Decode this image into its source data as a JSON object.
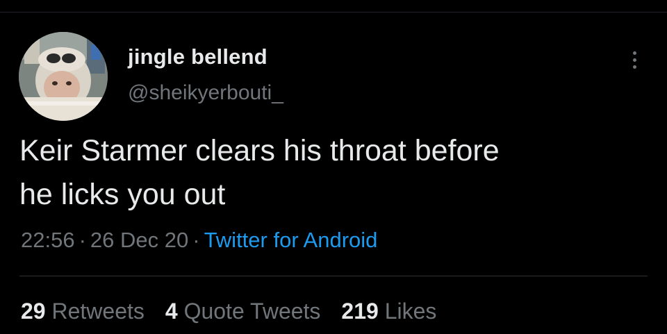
{
  "colors": {
    "background": "#000000",
    "text_primary": "#e7e9ea",
    "text_secondary": "#71767b",
    "link": "#1d9bf0",
    "divider": "#2f3336"
  },
  "tweet": {
    "author": {
      "display_name": "jingle bellend",
      "handle": "@sheikyerbouti_",
      "avatar_icon": "profile-photo"
    },
    "more_icon": "more-vertical-icon",
    "text_line1": "Keir Starmer clears his throat before",
    "text_line2": "he licks you out",
    "time": "22:56",
    "separator": "·",
    "date": "26 Dec 20",
    "source": "Twitter for Android",
    "stats": {
      "retweets_count": "29",
      "retweets_label": "Retweets",
      "quotes_count": "4",
      "quotes_label": "Quote Tweets",
      "likes_count": "219",
      "likes_label": "Likes"
    }
  }
}
